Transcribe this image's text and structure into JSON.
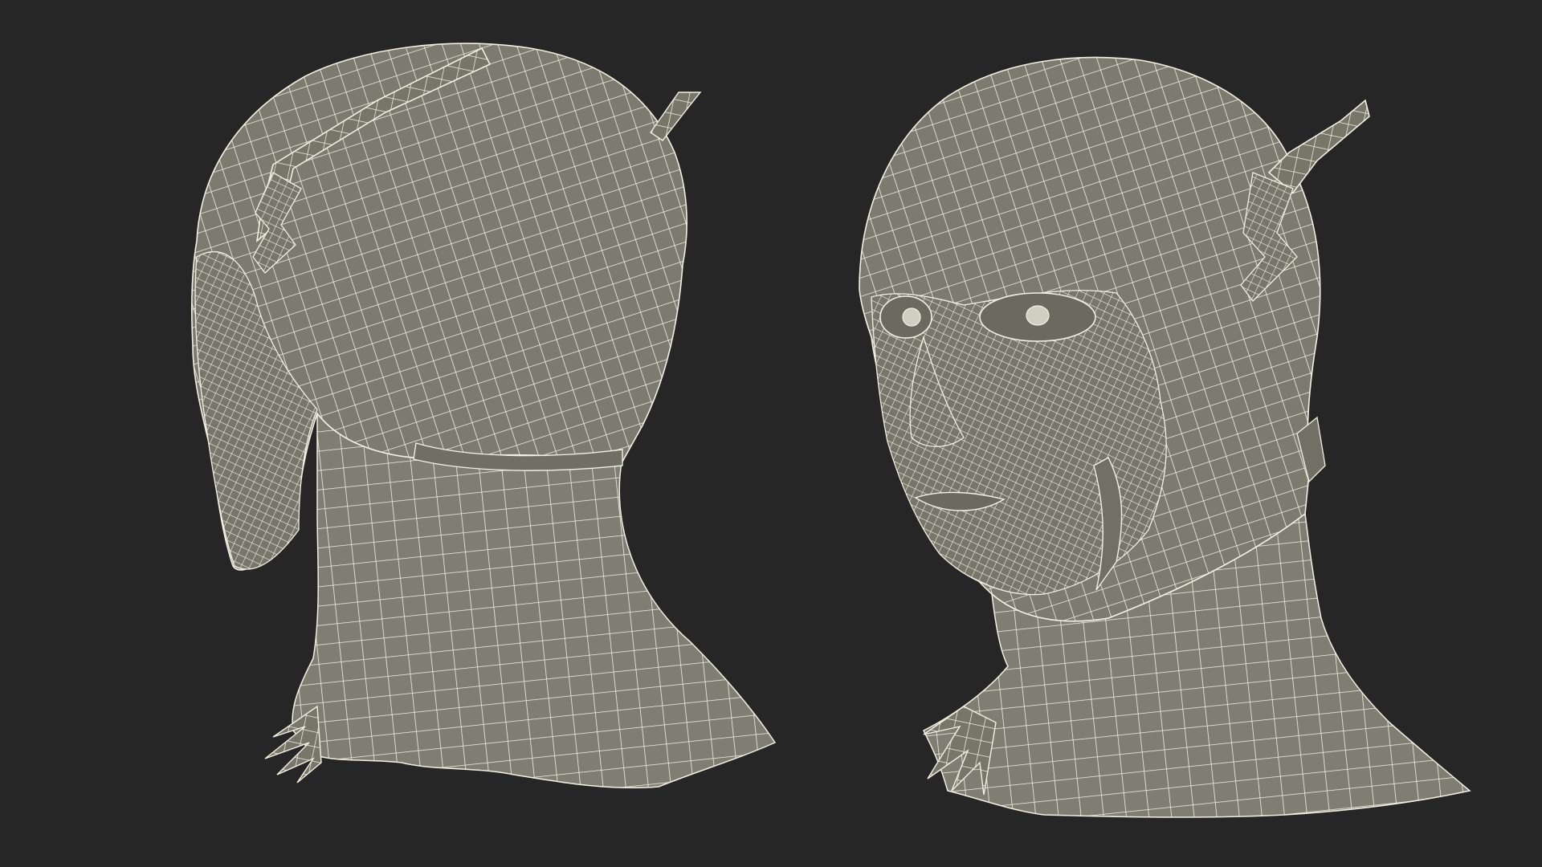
{
  "scene": {
    "background_color": "#262626",
    "mesh_fill_color": "#7b7b6f",
    "mesh_line_color": "#f2f0e2",
    "views": [
      {
        "name": "back-three-quarter-view",
        "description_icon": "wireframe-head-rear"
      },
      {
        "name": "front-three-quarter-view",
        "description_icon": "wireframe-head-front"
      }
    ]
  }
}
